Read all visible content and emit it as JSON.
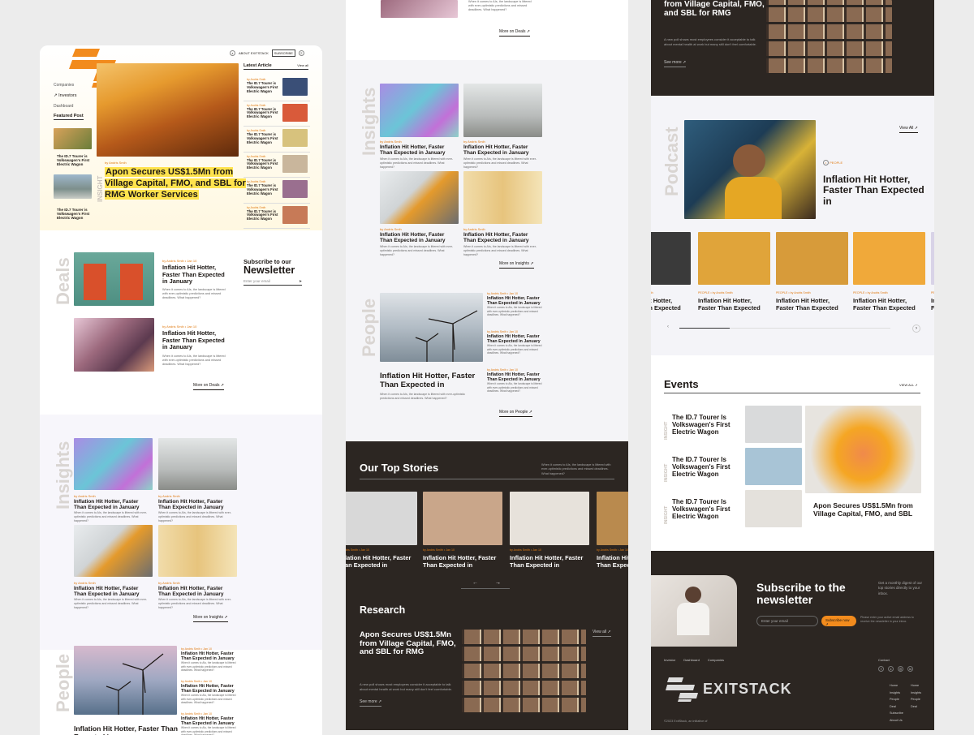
{
  "brand": {
    "name": "EXITSTACK",
    "accent": "#f28b1d",
    "highlight": "#ffe34d",
    "dark_bg": "#2c2622"
  },
  "header": {
    "about": "ABOUT EXITSTACK",
    "subscribe": "SUBSCRIBE"
  },
  "nav": {
    "companies": "Companies",
    "investors": "Investors",
    "dashboard": "Dashboard"
  },
  "hero": {
    "tag": "INSIGHT",
    "author": "by Andris Smih",
    "title": "Apon Secures US$1.5Mn from Village Capital, FMO, and SBL for RMG Worker Services"
  },
  "featured": {
    "label": "Featured Post",
    "items": [
      "The ID.7 Tourer is Volkswagen's First Electric Wagon",
      "The ID.7 Tourer is Volkswagen's First Electric Wagon"
    ]
  },
  "latest": {
    "title": "Latest Article",
    "view_all": "View all",
    "item": "The ID.7 Tourer is Volkswagen's First Electric Wagon"
  },
  "deals": {
    "label": "Deals",
    "title": "Inflation Hit Hotter, Faster Than Expected in January",
    "body": "When it comes to AIs, the landscape is littered with ever-optimistic predictions and missed deadlines. What happened?",
    "author": "by Andris Smih",
    "date": "Jan 10",
    "more": "More on Deals"
  },
  "newsletter": {
    "pre": "Subscribe to our",
    "title": "Newsletter",
    "placeholder": "Enter your email"
  },
  "insights": {
    "label": "Insights",
    "title": "Inflation Hit Hotter, Faster Than Expected in January",
    "body": "When it comes to AIs, the landscape is littered with ever-optimistic predictions and missed deadlines. What happened?",
    "author": "by Andris Smih",
    "more": "More on Insights"
  },
  "people": {
    "label": "People",
    "title": "Inflation Hit Hotter, Faster Than Expected in January",
    "main_title": "Inflation Hit Hotter, Faster Than Expected in",
    "body": "When it comes to AIs, the landscape is littered with ever-optimistic predictions and missed deadlines. What happened?",
    "author": "by Andris Smih",
    "date": "Jan 10",
    "more": "More on People"
  },
  "top_stories": {
    "title": "Our Top Stories",
    "desc": "When it comes to AIs, the landscape is littered with ever-optimistic predictions and missed deadlines. What happened?",
    "author": "by Andris Smith",
    "date": "Jan 10",
    "card_title": "Inflation Hit Hotter, Faster Than Expected in"
  },
  "research": {
    "title": "Research",
    "headline": "Apon Secures US$1.5Mn from Village Capital, FMO, and SBL for RMG",
    "body": "A new poll shows most employees consider it acceptable to talk about mental health at work but many still don't feel comfortable.",
    "see_more": "See more",
    "view_all": "View all"
  },
  "research_top": {
    "headline": "from Village Capital, FMO, and SBL for RMG",
    "body": "A new poll shows most employees consider it acceptable to talk about mental health at work but many still don't feel comfortable.",
    "see_more": "See more"
  },
  "deals_top_more": "More on Deals",
  "podcast": {
    "label": "Podcast",
    "view_all": "View All",
    "tag": "PEOPLE",
    "title": "Inflation Hit Hotter, Faster Than Expected in",
    "card_title": "Inflation Hit Hotter, Faster Than Expected",
    "author": "by Andris Smith"
  },
  "events": {
    "title": "Events",
    "view_all": "VIEW ALL",
    "tag": "INSIGHT",
    "item": "The ID.7 Tourer Is Volkswagen's First Electric Wagon",
    "feature": "Apon Secures US$1.5Mn from Village Capital, FMO, and SBL"
  },
  "subscribe": {
    "title": "Subscribe to the newsletter",
    "desc": "Get a monthly digest of our top stories directly to your inbox.",
    "placeholder": "Enter your email",
    "button": "Subscribe now",
    "note": "Please enter your active email address to receive the newsletter in your inbox."
  },
  "footer": {
    "links": [
      "Investor",
      "Dashboard",
      "Companies"
    ],
    "contact": "Contact",
    "col1": [
      "Home",
      "Insights",
      "People",
      "Deal",
      "Subscribe",
      "About Us"
    ],
    "col2": [
      "Home",
      "Insights",
      "People",
      "Deal"
    ],
    "copyright": "©2023 ExitStack, an initiative of"
  }
}
